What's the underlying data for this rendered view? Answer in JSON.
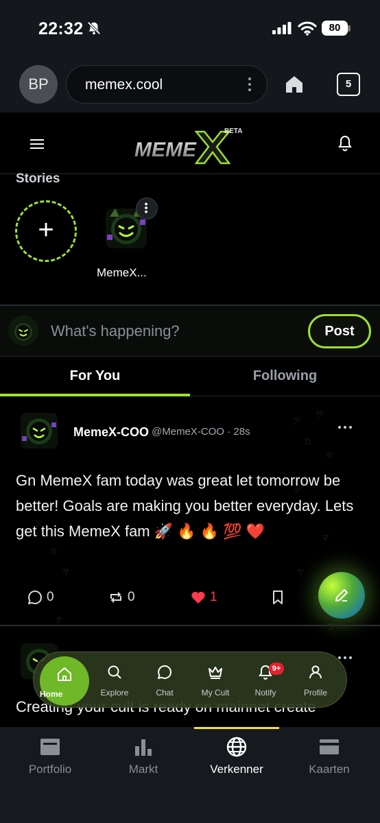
{
  "status": {
    "time": "22:32",
    "battery": "80"
  },
  "browser": {
    "avatar_initials": "BP",
    "url": "memex.cool",
    "tab_count": "5"
  },
  "app": {
    "logo_text": "MEMEX",
    "logo_tag": "BETA"
  },
  "stories": {
    "title": "Stories",
    "items": [
      {
        "name": "MemeX..."
      }
    ]
  },
  "compose": {
    "placeholder": "What's happening?",
    "post_label": "Post"
  },
  "tabs": {
    "for_you": "For You",
    "following": "Following",
    "active": "For You"
  },
  "posts": [
    {
      "author": "MemeX-COO",
      "handle": "@MemeX-COO · 28s",
      "text": "Gn MemeX fam today was great let tomorrow be better! Goals are making you better everyday. Lets get this MemeX fam 🚀 🔥 🔥 💯 ❤️",
      "replies": "0",
      "reposts": "0",
      "likes": "1"
    },
    {
      "text": "Creating your cult is ready on mainnet create"
    }
  ],
  "floating_nav": {
    "items": [
      {
        "label": "Home",
        "icon": "home-icon"
      },
      {
        "label": "Explore",
        "icon": "search-icon"
      },
      {
        "label": "Chat",
        "icon": "chat-icon"
      },
      {
        "label": "My Cult",
        "icon": "crown-icon"
      },
      {
        "label": "Notify",
        "icon": "bell-icon"
      },
      {
        "label": "Profile",
        "icon": "user-icon"
      }
    ],
    "notify_badge": "9+",
    "accent": "#6fb828"
  },
  "bottom_nav": {
    "items": [
      {
        "label": "Portfolio",
        "icon": "portfolio-icon"
      },
      {
        "label": "Markt",
        "icon": "bar-chart-icon"
      },
      {
        "label": "Verkenner",
        "icon": "globe-icon"
      },
      {
        "label": "Kaarten",
        "icon": "card-icon"
      }
    ],
    "active": "Verkenner",
    "active_color": "#f4e03a"
  },
  "colors": {
    "accent": "#9ee22a",
    "like": "#ff3b4e",
    "background": "#000000"
  }
}
